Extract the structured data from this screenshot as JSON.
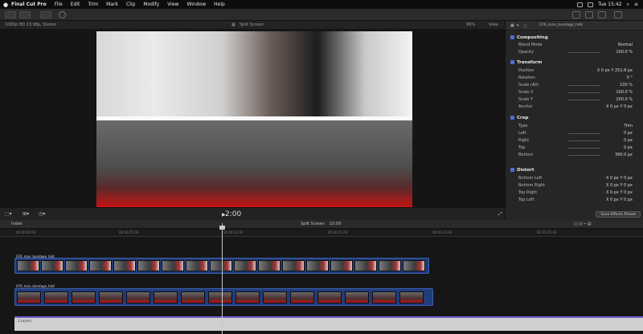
{
  "menubar": {
    "apple": "",
    "app_name": "Final Cut Pro",
    "items": [
      "File",
      "Edit",
      "Trim",
      "Mark",
      "Clip",
      "Modify",
      "View",
      "Window",
      "Help"
    ],
    "clock": "Tue 15:42"
  },
  "viewer": {
    "format": "1080p HD 23.98p, Stereo",
    "title": "Split Screen",
    "zoom": "99%",
    "view_label": "View"
  },
  "playback": {
    "timecode": "2:00"
  },
  "inspector": {
    "clip_name": "076_man_bandage_hdd",
    "sections": [
      {
        "name": "Compositing",
        "rows": [
          {
            "label": "Blend Mode",
            "value": "Normal"
          },
          {
            "label": "Opacity",
            "value": "100.0 %"
          }
        ]
      },
      {
        "name": "Transform",
        "rows": [
          {
            "label": "Position",
            "value": "X   0 px   Y  251.8 px"
          },
          {
            "label": "Rotation",
            "value": "0 °"
          },
          {
            "label": "Scale (All)",
            "value": "100 %"
          },
          {
            "label": "Scale X",
            "value": "100.0 %"
          },
          {
            "label": "Scale Y",
            "value": "100.0 %"
          },
          {
            "label": "Anchor",
            "value": "X   0 px   Y   0 px"
          }
        ]
      },
      {
        "name": "Crop",
        "rows": [
          {
            "label": "Type",
            "value": "Trim"
          },
          {
            "label": "Left",
            "value": "0 px"
          },
          {
            "label": "Right",
            "value": "0 px"
          },
          {
            "label": "Top",
            "value": "0 px"
          },
          {
            "label": "Bottom",
            "value": "390.0 px"
          }
        ]
      },
      {
        "name": "Distort",
        "rows": [
          {
            "label": "Bottom Left",
            "value": "X   0 px   Y   0 px"
          },
          {
            "label": "Bottom Right",
            "value": "X   0 px   Y   0 px"
          },
          {
            "label": "Top Right",
            "value": "X   0 px   Y   0 px"
          },
          {
            "label": "Top Left",
            "value": "X   0 px   Y   0 px"
          }
        ]
      }
    ],
    "save_button": "Save Effects Preset"
  },
  "timeline": {
    "index_label": "Index",
    "project_name": "Split Screen",
    "duration": "10:00",
    "ruler_marks": [
      "00:00:00:00",
      "00:00:05:00",
      "00:00:10:00",
      "00:00:15:00",
      "00:00:20:00",
      "00:00:25:00"
    ],
    "clip_a_name": "076_man_bandage_hdd",
    "clip_b_name": "076_man_bandage_hdd",
    "audio_label": "3 Layers"
  }
}
